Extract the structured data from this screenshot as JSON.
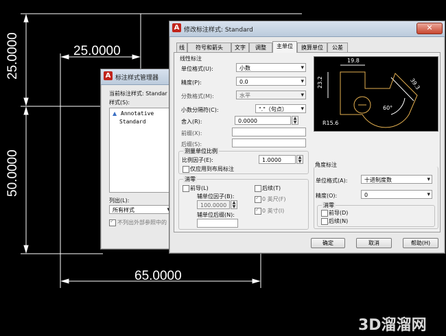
{
  "cad": {
    "dims": {
      "top_horizontal": "25.0000",
      "left_vertical_top": "25.0000",
      "left_vertical_bottom": "50.0000",
      "bottom_horizontal": "65.0000"
    }
  },
  "manager": {
    "title": "标注样式管理器",
    "current_style_label": "当前标注样式: Standar",
    "styles_label": "样式(S):",
    "styles": [
      "Annotative",
      "Standard"
    ],
    "list_label": "列出(L):",
    "list_value": "所有样式",
    "xref_checkbox": "不列出外部参照中的"
  },
  "modify": {
    "title": "修改标注样式: Standard",
    "close_glyph": "✕",
    "tabs": [
      "线",
      "符号和箭头",
      "文字",
      "调整",
      "主单位",
      "换算单位",
      "公差"
    ],
    "active_tab": "主单位",
    "linear": {
      "title": "线性标注",
      "unit_format_label": "单位格式(U):",
      "unit_format_value": "小数",
      "precision_label": "精度(P):",
      "precision_value": "0.0",
      "fraction_label": "分数格式(M):",
      "fraction_value": "水平",
      "decimal_sep_label": "小数分隔符(C):",
      "decimal_sep_value": "\".\"（句点）",
      "round_label": "舍入(R):",
      "round_value": "0.0000",
      "prefix_label": "前缀(X):",
      "suffix_label": "后缀(S):"
    },
    "scale": {
      "title": "测量单位比例",
      "factor_label": "比例因子(E):",
      "factor_value": "1.0000",
      "layout_only": "仅应用到布局标注"
    },
    "zero_left": {
      "title": "消零",
      "leading": "前导(L)",
      "sub_factor_label": "辅单位因子(B):",
      "sub_factor_value": "100.0000",
      "sub_suffix_label": "辅单位后缀(N):",
      "trailing": "后续(T)",
      "feet": "0 英尺(F)",
      "inches": "0 英寸(I)"
    },
    "preview": {
      "dim_top": "19.8",
      "dim_left": "23.2",
      "dim_right": "39.3",
      "angle": "60°",
      "radius": "R15.6"
    },
    "angular": {
      "title": "角度标注",
      "unit_format_label": "单位格式(A):",
      "unit_format_value": "十进制度数",
      "precision_label": "精度(O):",
      "precision_value": "0",
      "zero_title": "消零",
      "leading": "前导(D)",
      "trailing": "后续(N)"
    },
    "buttons": {
      "ok": "确定",
      "cancel": "取消",
      "help": "帮助(H)"
    }
  },
  "watermark": "3D溜溜网"
}
